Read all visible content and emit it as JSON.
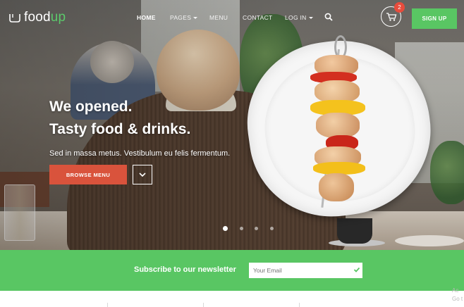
{
  "brand": {
    "name_prefix": "food",
    "name_suffix": "up"
  },
  "nav": {
    "items": [
      {
        "label": "HOME",
        "active": true,
        "has_caret": false
      },
      {
        "label": "PAGES",
        "active": false,
        "has_caret": true
      },
      {
        "label": "MENU",
        "active": false,
        "has_caret": false
      },
      {
        "label": "CONTACT",
        "active": false,
        "has_caret": false
      },
      {
        "label": "LOG IN",
        "active": false,
        "has_caret": true
      }
    ],
    "search_icon": "search-icon",
    "cart_icon": "cart-icon",
    "cart_count": "2",
    "signup_label": "SIGN UP"
  },
  "hero": {
    "headline_line1": "We opened.",
    "headline_line2": "Tasty food & drinks.",
    "subtext": "Sed in massa metus. Vestibulum eu felis fermentum.",
    "browse_label": "BROWSE MENU",
    "down_icon": "chevron-down-icon",
    "slides_total": 4,
    "active_slide": 1
  },
  "newsletter": {
    "label": "Subscribe to our newsletter",
    "placeholder": "Your Email",
    "submit_icon": "check-icon"
  },
  "footer_partial": {
    "corner_line1": "Ac",
    "corner_line2": "Go t"
  },
  "colors": {
    "accent_green": "#59c663",
    "browse_red": "#d9533c",
    "badge_red": "#e74c3c"
  }
}
